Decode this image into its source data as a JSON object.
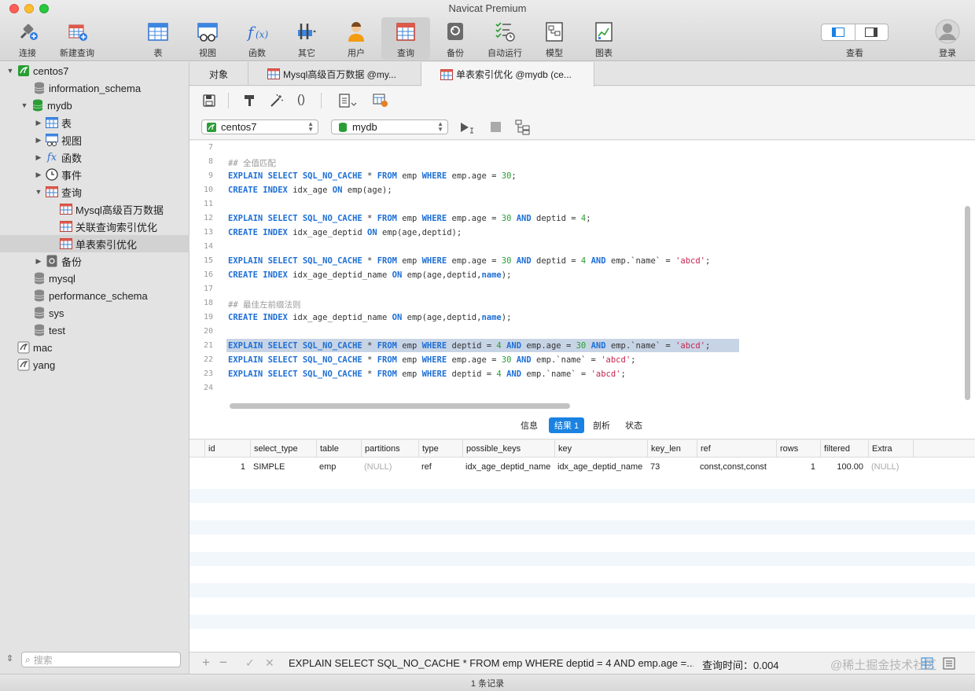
{
  "window": {
    "title": "Navicat Premium"
  },
  "toolbar": {
    "buttons": [
      {
        "label": "连接",
        "icon": "plug-icon"
      },
      {
        "label": "新建查询",
        "icon": "new-query-icon"
      },
      {
        "label": "表",
        "icon": "table-icon"
      },
      {
        "label": "视图",
        "icon": "view-icon"
      },
      {
        "label": "函数",
        "icon": "function-icon"
      },
      {
        "label": "其它",
        "icon": "tools-icon"
      },
      {
        "label": "用户",
        "icon": "user-icon"
      },
      {
        "label": "查询",
        "icon": "query-icon"
      },
      {
        "label": "备份",
        "icon": "backup-icon"
      },
      {
        "label": "自动运行",
        "icon": "schedule-icon"
      },
      {
        "label": "模型",
        "icon": "model-icon"
      },
      {
        "label": "图表",
        "icon": "chart-icon"
      }
    ],
    "view_label": "查看",
    "login_label": "登录"
  },
  "sidebar": {
    "items": [
      {
        "label": "centos7"
      },
      {
        "label": "information_schema"
      },
      {
        "label": "mydb"
      },
      {
        "label": "表"
      },
      {
        "label": "视图"
      },
      {
        "label": "函数"
      },
      {
        "label": "事件"
      },
      {
        "label": "查询"
      },
      {
        "label": "Mysql高级百万数据"
      },
      {
        "label": "关联查询索引优化"
      },
      {
        "label": "单表索引优化"
      },
      {
        "label": "备份"
      },
      {
        "label": "mysql"
      },
      {
        "label": "performance_schema"
      },
      {
        "label": "sys"
      },
      {
        "label": "test"
      },
      {
        "label": "mac"
      },
      {
        "label": "yang"
      }
    ],
    "search_placeholder": "搜索"
  },
  "tabs": [
    {
      "label": "对象"
    },
    {
      "label": "Mysql高级百万数据 @my..."
    },
    {
      "label": "单表索引优化 @mydb (ce..."
    }
  ],
  "connection": {
    "server": "centos7",
    "database": "mydb"
  },
  "editor": {
    "line_numbers": [
      "7",
      "8",
      "9",
      "10",
      "11",
      "12",
      "13",
      "14",
      "15",
      "16",
      "17",
      "18",
      "19",
      "20",
      "21",
      "22",
      "23",
      "24"
    ],
    "lines": [
      "",
      "## 全值匹配",
      "EXPLAIN SELECT SQL_NO_CACHE * FROM emp WHERE emp.age = 30;",
      "CREATE INDEX idx_age ON emp(age);",
      "",
      "EXPLAIN SELECT SQL_NO_CACHE * FROM emp WHERE emp.age = 30 AND deptid = 4;",
      "CREATE INDEX idx_age_deptid ON emp(age,deptid);",
      "",
      "EXPLAIN SELECT SQL_NO_CACHE * FROM emp WHERE emp.age = 30 AND deptid = 4 AND emp.`name` = 'abcd';",
      "CREATE INDEX idx_age_deptid_name ON emp(age,deptid,name);",
      "",
      "## 最佳左前缀法则",
      "CREATE INDEX idx_age_deptid_name ON emp(age,deptid,name);",
      "",
      "EXPLAIN SELECT SQL_NO_CACHE * FROM emp WHERE deptid = 4 AND emp.age = 30 AND emp.`name` = 'abcd';",
      "EXPLAIN SELECT SQL_NO_CACHE * FROM emp WHERE emp.age = 30 AND emp.`name` = 'abcd';",
      "EXPLAIN SELECT SQL_NO_CACHE * FROM emp WHERE deptid = 4 AND emp.`name` = 'abcd';",
      ""
    ]
  },
  "result_tabs": [
    {
      "label": "信息"
    },
    {
      "label": "结果 1"
    },
    {
      "label": "剖析"
    },
    {
      "label": "状态"
    }
  ],
  "grid": {
    "columns": [
      "id",
      "select_type",
      "table",
      "partitions",
      "type",
      "possible_keys",
      "key",
      "key_len",
      "ref",
      "rows",
      "filtered",
      "Extra"
    ],
    "rows": [
      [
        "1",
        "SIMPLE",
        "emp",
        "(NULL)",
        "ref",
        "idx_age_deptid_name",
        "idx_age_deptid_name",
        "73",
        "const,const,const",
        "1",
        "100.00",
        "(NULL)"
      ]
    ]
  },
  "bottom": {
    "sql_preview": "EXPLAIN SELECT SQL_NO_CACHE * FROM emp WHERE deptid = 4 AND emp.age =...",
    "query_time": "查询时间：0.004",
    "record_count": "1 条记录",
    "watermark": "@稀土掘金技术社区"
  },
  "colors": {
    "accent": "#1a82e2",
    "keyword": "#1e6fd6",
    "number": "#2a9d34",
    "string": "#c4244c",
    "selection": "#c7d4e6"
  }
}
